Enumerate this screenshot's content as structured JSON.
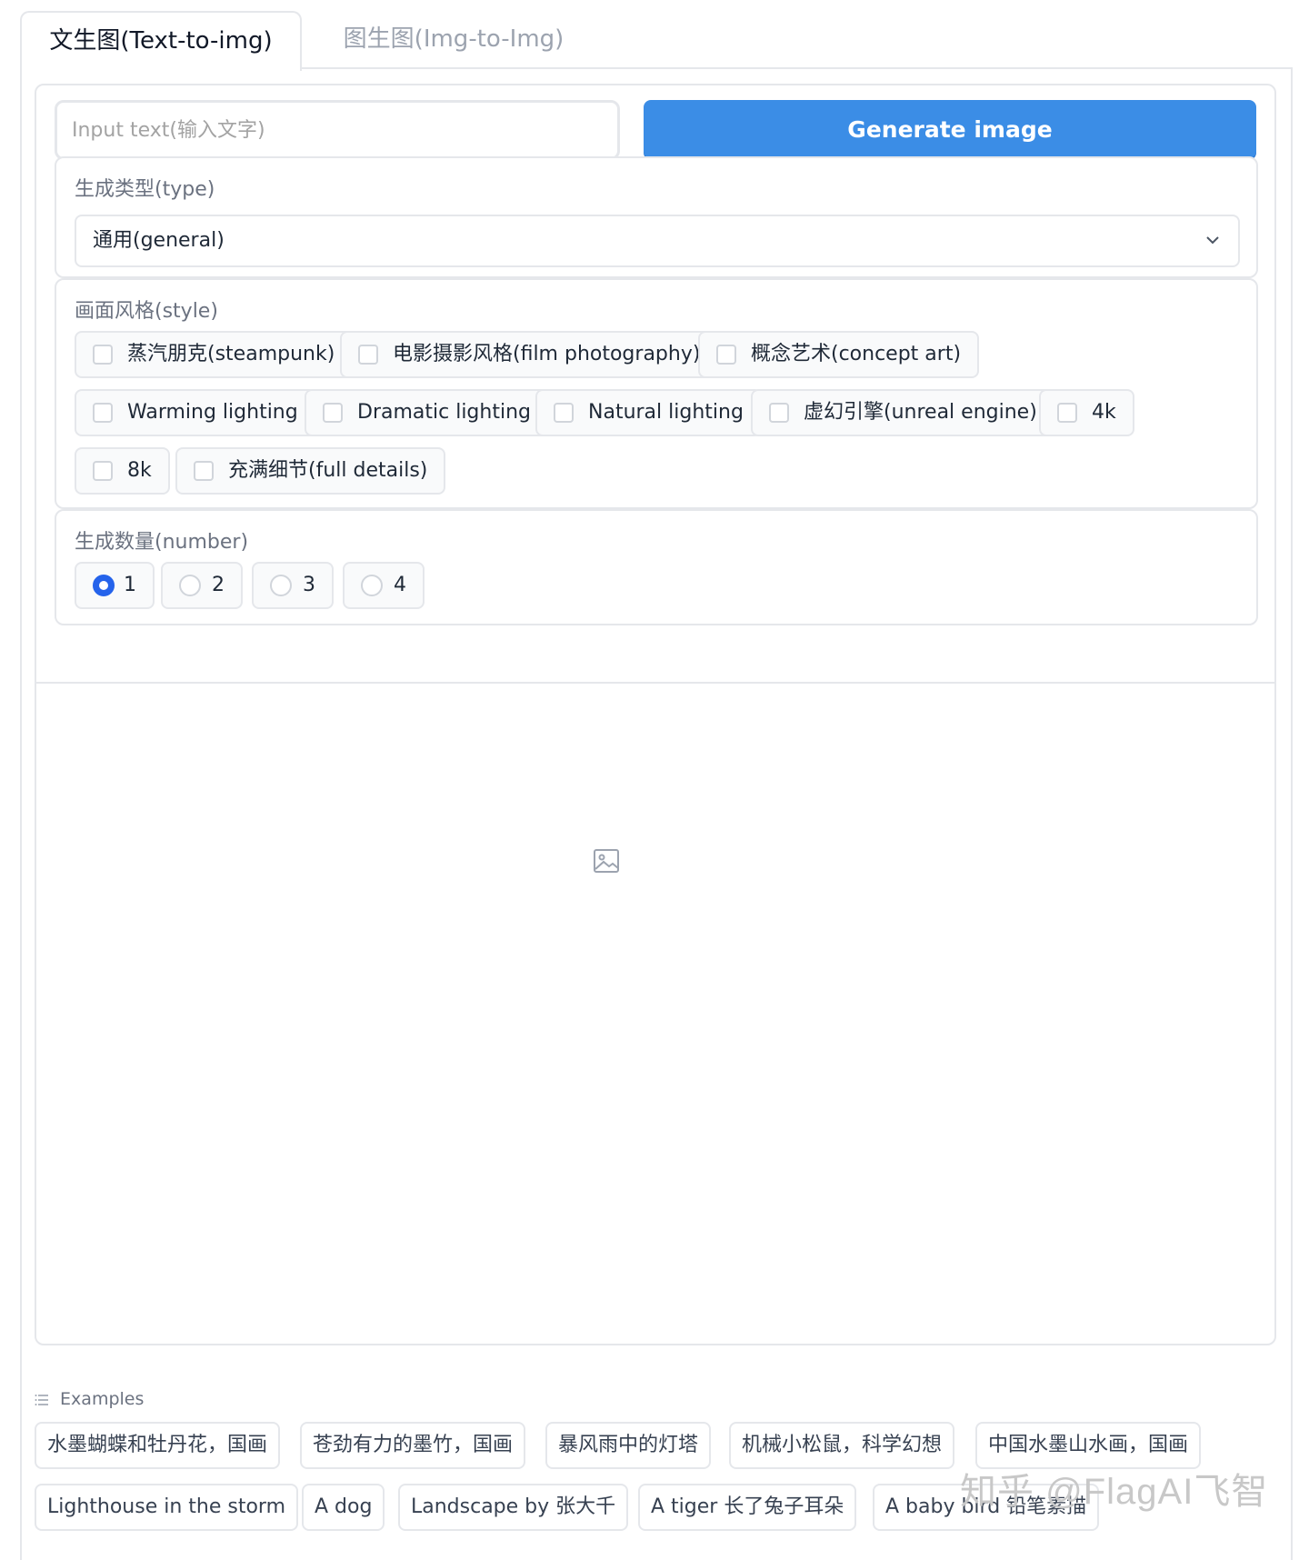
{
  "tabs": [
    {
      "label": "文生图(Text-to-img)",
      "active": true
    },
    {
      "label": "图生图(Img-to-Img)",
      "active": false
    }
  ],
  "prompt": {
    "placeholder": "Input text(输入文字)",
    "value": ""
  },
  "generate_button": {
    "label": "Generate image",
    "color": "#3b8de6"
  },
  "type_section": {
    "label": "生成类型(type)",
    "selected": "通用(general)"
  },
  "style_section": {
    "label": "画面风格(style)",
    "options": [
      {
        "label": "蒸汽朋克(steampunk)",
        "checked": false
      },
      {
        "label": "电影摄影风格(film photography)",
        "checked": false
      },
      {
        "label": "概念艺术(concept art)",
        "checked": false
      },
      {
        "label": "Warming lighting",
        "checked": false
      },
      {
        "label": "Dramatic lighting",
        "checked": false
      },
      {
        "label": "Natural lighting",
        "checked": false
      },
      {
        "label": "虚幻引擎(unreal engine)",
        "checked": false
      },
      {
        "label": "4k",
        "checked": false
      },
      {
        "label": "8k",
        "checked": false
      },
      {
        "label": "充满细节(full details)",
        "checked": false
      }
    ]
  },
  "number_section": {
    "label": "生成数量(number)",
    "options": [
      {
        "label": "1",
        "selected": true
      },
      {
        "label": "2",
        "selected": false
      },
      {
        "label": "3",
        "selected": false
      },
      {
        "label": "4",
        "selected": false
      }
    ]
  },
  "output": {
    "icon": "image-placeholder-icon"
  },
  "examples": {
    "label": "Examples",
    "items": [
      "水墨蝴蝶和牡丹花，国画",
      "苍劲有力的墨竹，国画",
      "暴风雨中的灯塔",
      "机械小松鼠，科学幻想",
      "中国水墨山水画，国画",
      "Lighthouse in the storm",
      "A dog",
      "Landscape by 张大千",
      "A tiger 长了兔子耳朵",
      "A baby bird 铅笔素描"
    ]
  },
  "watermark": "知乎 @FlagAI飞智"
}
